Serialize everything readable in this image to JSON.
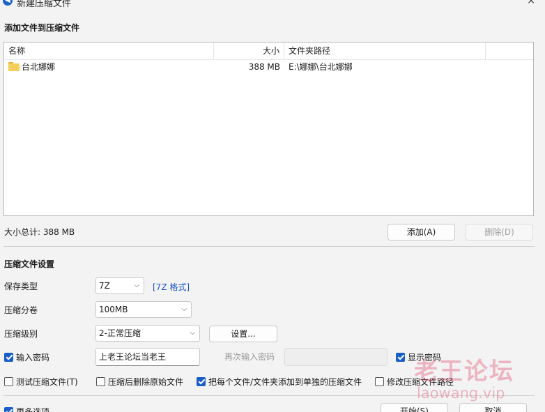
{
  "window": {
    "title": "新建压缩文件",
    "close": "×"
  },
  "files_section": {
    "title": "添加文件到压缩文件",
    "columns": {
      "name": "名称",
      "size": "大小",
      "path": "文件夹路径"
    },
    "rows": [
      {
        "name": "台北娜娜",
        "size": "388 MB",
        "path": "E:\\娜娜\\台北娜娜"
      }
    ],
    "total": "大小总计: 388 MB",
    "add_button": "添加(A)",
    "delete_button": "删除(D)"
  },
  "settings": {
    "title": "压缩文件设置",
    "save_type_label": "保存类型",
    "save_type_value": "7Z",
    "format_link": "[7Z 格式]",
    "split_label": "压缩分卷",
    "split_value": "100MB",
    "level_label": "压缩级别",
    "level_value": "2-正常压缩",
    "settings_button": "设置...",
    "password_checkbox": "输入密码",
    "password_value": "上老王论坛当老王",
    "reenter_label": "再次输入密码",
    "reenter_value": "",
    "show_password": "显示密码",
    "test_archive": "测试压缩文件(T)",
    "delete_after": "压缩后删除原始文件",
    "separate_archives": "把每个文件/文件夹添加到单独的压缩文件",
    "change_path": "修改压缩文件路径"
  },
  "bottom": {
    "more_options": "更多选项",
    "start_button": "开始(S)",
    "cancel_button": "取消"
  },
  "watermark": {
    "main": "老王论坛",
    "sub": "laowang.vip"
  },
  "checkbox_states": {
    "password": true,
    "show_password": true,
    "test_archive": false,
    "delete_after": false,
    "separate_archives": true,
    "change_path": false,
    "more_options": true
  },
  "colors": {
    "accent": "#1a5fc8",
    "link": "#1a56c8",
    "watermark": "#e2506e"
  },
  "icons": {
    "title": "app-icon",
    "folder": "folder-icon",
    "chevron": "chevron-down-icon"
  }
}
